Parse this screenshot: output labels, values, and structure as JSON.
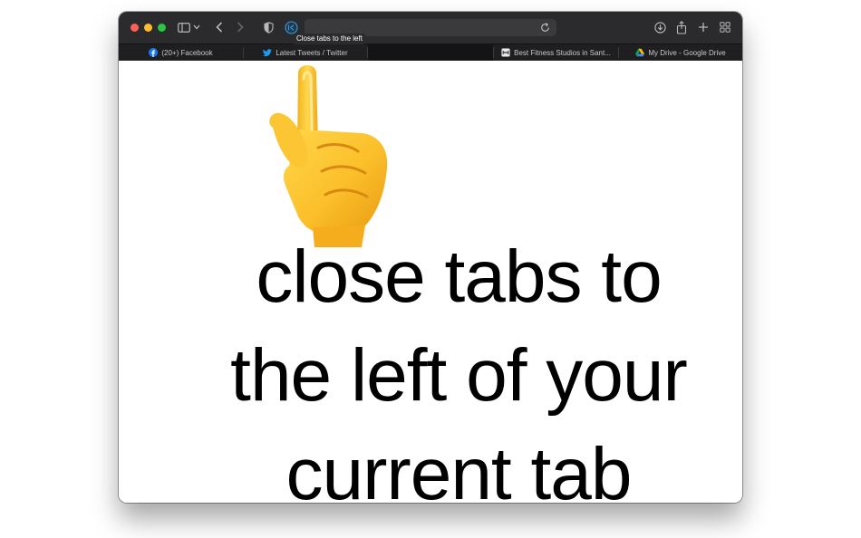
{
  "browser": {
    "tooltip": "Close tabs to the left",
    "address": ""
  },
  "tabs": [
    {
      "label": "(20+) Facebook",
      "icon": "facebook-icon"
    },
    {
      "label": "Latest Tweets / Twitter",
      "icon": "twitter-icon"
    },
    {
      "label": "",
      "icon": ""
    },
    {
      "label": "Best Fitness Studios in Sant...",
      "icon": "fitness-site-icon"
    },
    {
      "label": "My Drive - Google Drive",
      "icon": "google-drive-icon"
    }
  ],
  "page": {
    "headline_line1": "close tabs to",
    "headline_line2": "the left of your",
    "headline_line3": "current tab",
    "pointer_emoji": "hand-pointing-up"
  },
  "colors": {
    "toolbar": "#2b2b2d",
    "tabbar": "#1f1f21",
    "close_red": "#ff5f57",
    "minimize_yellow": "#febc2e",
    "zoom_green": "#28c840",
    "accent_blue": "#3a9bdc"
  }
}
